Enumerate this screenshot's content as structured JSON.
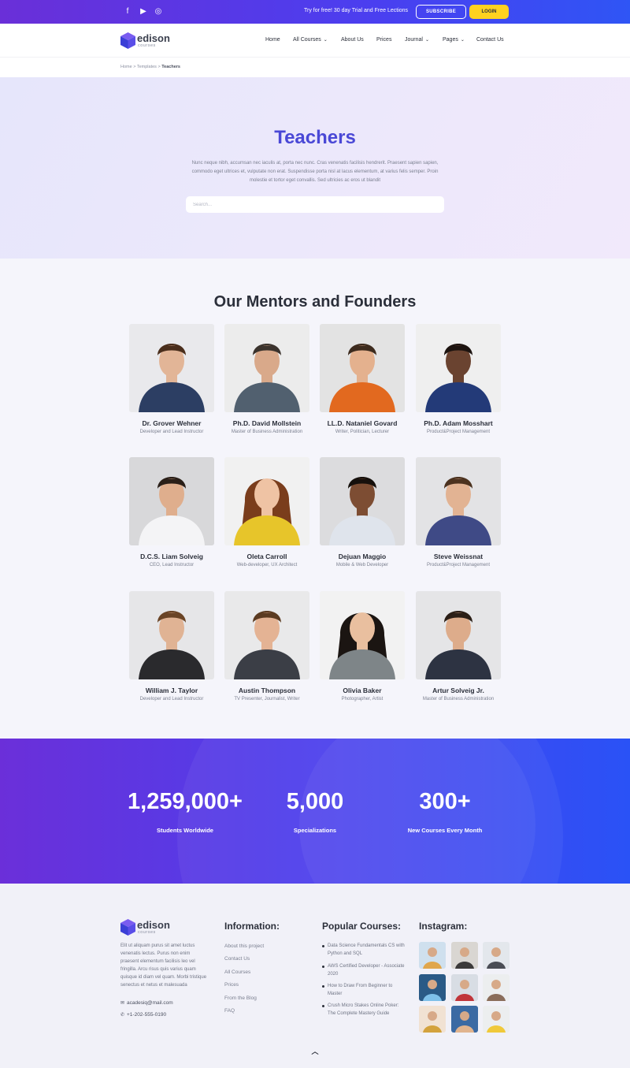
{
  "topbar": {
    "social": [
      {
        "icon": "facebook-icon",
        "glyph": "f"
      },
      {
        "icon": "youtube-icon",
        "glyph": "▶"
      },
      {
        "icon": "instagram-icon",
        "glyph": "◎"
      }
    ],
    "promo_text": "Try for free! 30 day Trial and Free Lections",
    "subscribe_label": "SUBSCRIBE",
    "login_label": "LOGIN"
  },
  "header": {
    "logo_name": "edison",
    "logo_sub": "courses",
    "nav": [
      {
        "label": "Home",
        "dropdown": false
      },
      {
        "label": "All Courses",
        "dropdown": true
      },
      {
        "label": "About Us",
        "dropdown": false
      },
      {
        "label": "Prices",
        "dropdown": false
      },
      {
        "label": "Journal",
        "dropdown": true
      },
      {
        "label": "Pages",
        "dropdown": true
      },
      {
        "label": "Contact Us",
        "dropdown": false
      }
    ]
  },
  "breadcrumb": {
    "home": "Home",
    "sep": " > ",
    "templates": "Templates",
    "current": "Teachers"
  },
  "hero": {
    "title": "Teachers",
    "description": "Nunc neque nibh, accumsan nec iaculis at, porta nec nunc. Cras venenatis facilisis hendrerit. Praesent sapien sapien, commodo eget ultrices et, vulputate non erat. Suspendisse porta nisl at lacus elementum, at varius felis semper. Proin molestie et tortor eget convallis. Sed ultricies ac eros ut blandit",
    "search_placeholder": "Search..."
  },
  "mentors": {
    "title": "Our Mentors and Founders",
    "people": [
      {
        "name": "Dr. Grover Wehner",
        "role": "Developer and Lead Instructor",
        "shirt": "#2c3e63",
        "bg": "#e9e9ec",
        "skin": "#e2b597",
        "hair": "#4a2e1c"
      },
      {
        "name": "Ph.D. David Mollstein",
        "role": "Master of Business Administration",
        "shirt": "#51606f",
        "bg": "#ececec",
        "skin": "#d9a98a",
        "hair": "#3b332d"
      },
      {
        "name": "LL.D. Nataniel Govard",
        "role": "Writer, Politician, Lecturer",
        "shirt": "#e2691f",
        "bg": "#e3e3e3",
        "skin": "#e4b18e",
        "hair": "#3d2b1e"
      },
      {
        "name": "Ph.D. Adam Mosshart",
        "role": "Product&Project Management",
        "shirt": "#233a78",
        "bg": "#efefef",
        "skin": "#6a4330",
        "hair": "#1d1410"
      },
      {
        "name": "D.C.S. Liam Solveig",
        "role": "CEO, Lead Instructor",
        "shirt": "#f4f4f6",
        "bg": "#d8d8da",
        "skin": "#dfae8d",
        "hair": "#2a1f18"
      },
      {
        "name": "Oleta Carroll",
        "role": "Web-developer, UX Architect",
        "shirt": "#e7c52a",
        "bg": "#f1f1f1",
        "skin": "#efc3a4",
        "hair": "#7a3d1c"
      },
      {
        "name": "Dejuan Maggio",
        "role": "Mobile & Web Developer",
        "shirt": "#dfe4ec",
        "bg": "#dcdcde",
        "skin": "#7d4d33",
        "hair": "#16100c"
      },
      {
        "name": "Steve Weissnat",
        "role": "Product&Project Management",
        "shirt": "#3f4a86",
        "bg": "#e3e3e5",
        "skin": "#e2b393",
        "hair": "#4c321f"
      },
      {
        "name": "William J. Taylor",
        "role": "Developer and Lead Instructor",
        "shirt": "#2a2a2d",
        "bg": "#e6e6e8",
        "skin": "#e0b394",
        "hair": "#6a4426"
      },
      {
        "name": "Austin Thompson",
        "role": "TV Presenter, Journalist, Writer",
        "shirt": "#3b3e46",
        "bg": "#e9e9ea",
        "skin": "#e4b394",
        "hair": "#5b3b21"
      },
      {
        "name": "Olivia Baker",
        "role": "Photographer, Artist",
        "shirt": "#7e8588",
        "bg": "#f2f2f2",
        "skin": "#e9bf9f",
        "hair": "#1b1512"
      },
      {
        "name": "Artur Solveig Jr.",
        "role": "Master of Business Administration",
        "shirt": "#2d3342",
        "bg": "#e5e5e7",
        "skin": "#ddac8b",
        "hair": "#2b1f17"
      }
    ]
  },
  "stats": [
    {
      "value": "1,259,000+",
      "label": "Students Worldwide"
    },
    {
      "value": "5,000",
      "label": "Specializations"
    },
    {
      "value": "300+",
      "label": "New Courses Every Month"
    }
  ],
  "footer": {
    "about": "Elit ut aliquam purus sit amet luctus venenatis lectus. Purus non enim praesent elementum facilisis leo vel fringilla. Arcu risus quis varius quam quisque id diam vel quam. Morbi tristique senectus et netus et malesuada",
    "email": "acadesiq@mail.com",
    "phone": "+1-202-555-0190",
    "info_title": "Information:",
    "info_links": [
      "About this project",
      "Contact Us",
      "All Courses",
      "Prices",
      "From the Blog",
      "FAQ"
    ],
    "courses_title": "Popular Courses:",
    "courses": [
      "Data Science Fundamentals CS with Python and SQL",
      "AWS Certified Developer - Associate 2020",
      "How to Draw From Beginner to Master",
      "Crush Micro Stakes Online Poker: The Complete Mastery Guide"
    ],
    "insta_title": "Instagram:",
    "insta_photos": [
      {
        "bg": "#cfe0ee",
        "accent": "#e0a64c"
      },
      {
        "bg": "#d9d6d2",
        "accent": "#3c3a3a"
      },
      {
        "bg": "#e3e7ec",
        "accent": "#4a4d55"
      },
      {
        "bg": "#2a5a86",
        "accent": "#7ec0e9"
      },
      {
        "bg": "#d8dde4",
        "accent": "#c0353a"
      },
      {
        "bg": "#eceeef",
        "accent": "#8a6d5a"
      },
      {
        "bg": "#f1e2d3",
        "accent": "#d3a23d"
      },
      {
        "bg": "#3b6aa3",
        "accent": "#e1b48e"
      },
      {
        "bg": "#eceeef",
        "accent": "#f0c93a"
      }
    ]
  },
  "colors": {
    "brand": "#4a48d6",
    "accent": "#ffd21f"
  }
}
